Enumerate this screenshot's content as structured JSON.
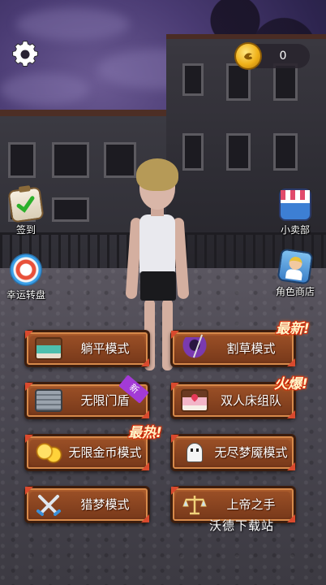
{
  "header": {
    "settings_icon": "gear-icon",
    "coin_icon": "gold-coin-icon",
    "coins": "0"
  },
  "side_left": [
    {
      "label": "签到",
      "icon": "clipboard-check-icon"
    },
    {
      "label": "幸运转盘",
      "icon": "lucky-wheel-icon"
    }
  ],
  "side_right": [
    {
      "label": "小卖部",
      "icon": "shop-stall-icon"
    },
    {
      "label": "角色商店",
      "icon": "character-shop-icon"
    }
  ],
  "modes": [
    {
      "label": "躺平模式",
      "icon": "bed-icon"
    },
    {
      "label": "割草模式",
      "icon": "reaper-icon"
    },
    {
      "label": "无限门盾",
      "icon": "door-shield-icon"
    },
    {
      "label": "双人床组队",
      "icon": "double-bed-icon"
    },
    {
      "label": "无限金币模式",
      "icon": "gold-coins-icon"
    },
    {
      "label": "无尽梦魇模式",
      "icon": "ghost-icon"
    },
    {
      "label": "猎梦模式",
      "icon": "crossed-swords-icon"
    },
    {
      "label": "上帝之手",
      "icon": "scales-icon"
    }
  ],
  "badges": {
    "latest": "最新!",
    "hot_fire": "火爆!",
    "hottest": "最热!",
    "new_ribbon": "新"
  },
  "watermark": "沃德下载站",
  "colors": {
    "button_brown": "#8d4420",
    "button_border": "#3b1d0e",
    "badge_red": "#d42a0c",
    "sky_purple": "#4a3b73"
  }
}
